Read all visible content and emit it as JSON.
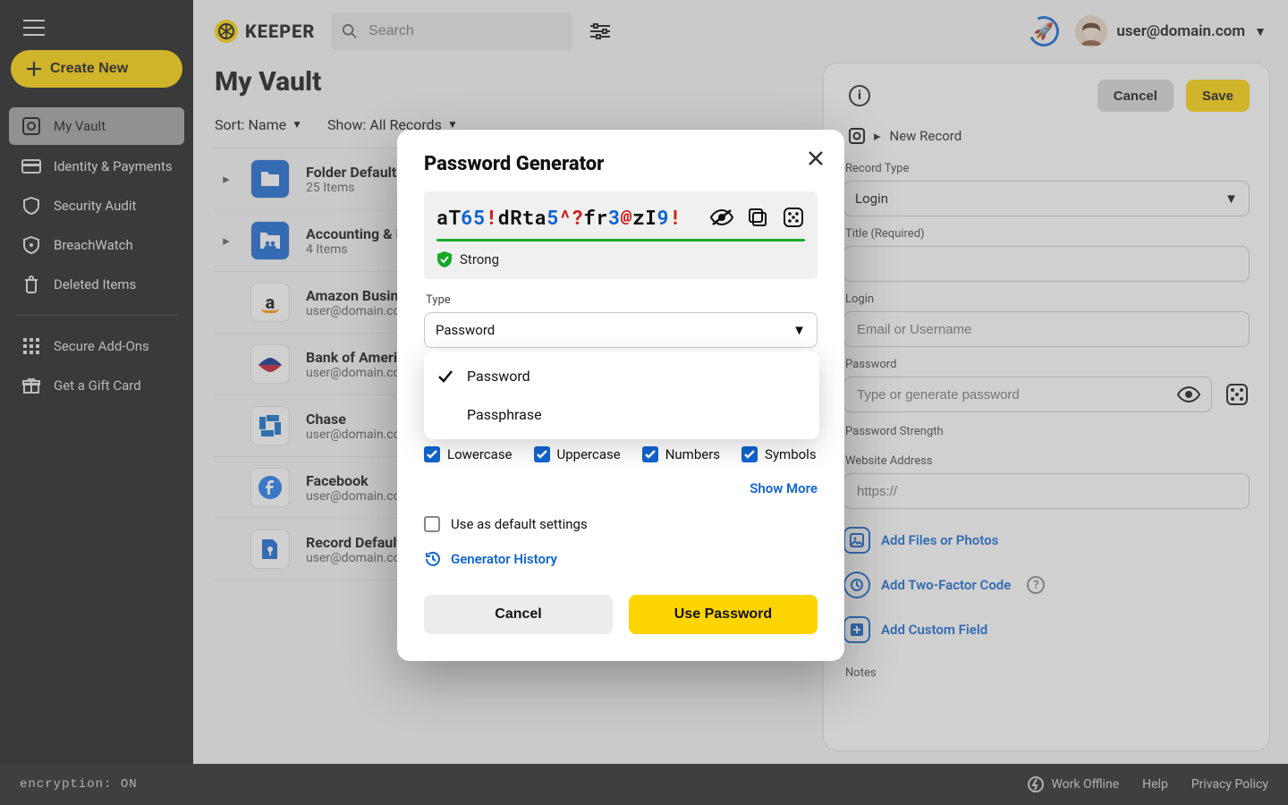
{
  "brand": "KEEPER",
  "user_email": "user@domain.com",
  "search_placeholder": "Search",
  "create_label": "Create New",
  "nav": {
    "my_vault": "My Vault",
    "identity": "Identity & Payments",
    "security": "Security Audit",
    "breachwatch": "BreachWatch",
    "deleted": "Deleted Items",
    "addons": "Secure Add-Ons",
    "gift": "Get a Gift Card"
  },
  "page_title": "My Vault",
  "sort_label": "Sort: Name",
  "show_label": "Show: All Records",
  "records": [
    {
      "name": "Folder Default",
      "sub": "25 Items",
      "kind": "folder",
      "expandable": true
    },
    {
      "name": "Accounting & Finance",
      "sub": "4 Items",
      "kind": "sharedfolder",
      "expandable": true
    },
    {
      "name": "Amazon Business",
      "sub": "user@domain.com",
      "kind": "amazon"
    },
    {
      "name": "Bank of America",
      "sub": "user@domain.com",
      "kind": "boa"
    },
    {
      "name": "Chase",
      "sub": "user@domain.com",
      "kind": "chase"
    },
    {
      "name": "Facebook",
      "sub": "user@domain.com",
      "kind": "facebook"
    },
    {
      "name": "Record Default",
      "sub": "user@domain.com",
      "kind": "record"
    }
  ],
  "panel": {
    "cancel": "Cancel",
    "save": "Save",
    "crumb_new": "New Record",
    "record_type_label": "Record Type",
    "record_type_value": "Login",
    "title_label": "Title (Required)",
    "login_label": "Login",
    "login_placeholder": "Email or Username",
    "password_label": "Password",
    "password_placeholder": "Type or generate password",
    "strength_label": "Password Strength",
    "website_label": "Website Address",
    "website_placeholder": "https://",
    "add_files": "Add Files or Photos",
    "add_2fa": "Add Two-Factor Code",
    "add_custom": "Add Custom Field",
    "notes": "Notes"
  },
  "modal": {
    "title": "Password Generator",
    "password_plain": "aT65!dRta5^?fr3@zI9!",
    "password_segments": [
      {
        "t": "aT",
        "c": "k"
      },
      {
        "t": "65",
        "c": "n"
      },
      {
        "t": "!",
        "c": "s"
      },
      {
        "t": "dRta",
        "c": "k"
      },
      {
        "t": "5",
        "c": "n"
      },
      {
        "t": "^?",
        "c": "s"
      },
      {
        "t": "fr",
        "c": "k"
      },
      {
        "t": "3",
        "c": "n"
      },
      {
        "t": "@",
        "c": "s"
      },
      {
        "t": "zI",
        "c": "k"
      },
      {
        "t": "9",
        "c": "n"
      },
      {
        "t": "!",
        "c": "s"
      }
    ],
    "strength": "Strong",
    "type_label": "Type",
    "type_value": "Password",
    "type_options": [
      "Password",
      "Passphrase"
    ],
    "type_selected_index": 0,
    "check_lower": "Lowercase",
    "check_upper": "Uppercase",
    "check_numbers": "Numbers",
    "check_symbols": "Symbols",
    "show_more": "Show More",
    "use_default": "Use as default settings",
    "history": "Generator History",
    "cancel": "Cancel",
    "use": "Use Password"
  },
  "bottom": {
    "encryption": "encryption: ON",
    "work_offline": "Work Offline",
    "help": "Help",
    "privacy": "Privacy Policy"
  }
}
